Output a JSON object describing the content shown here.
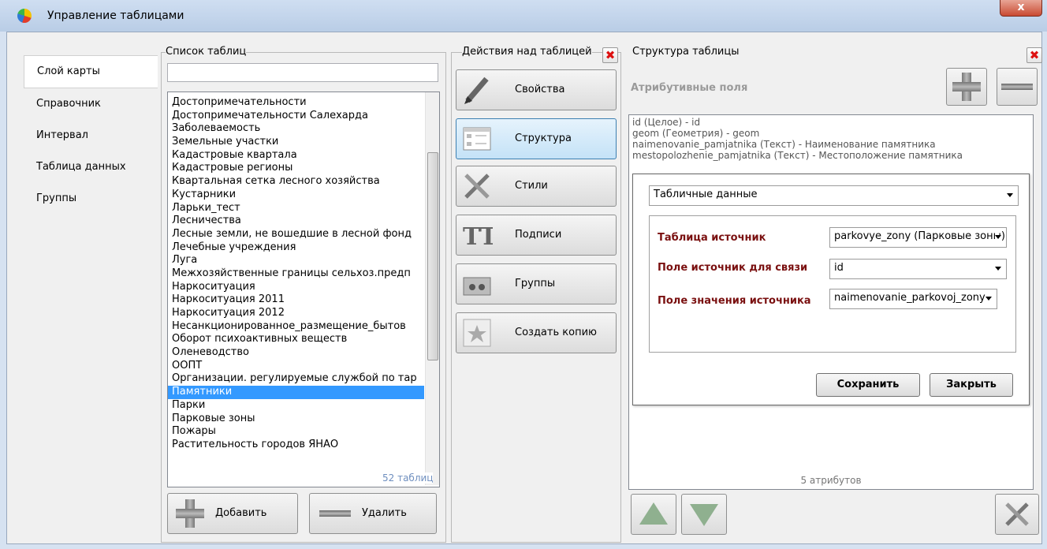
{
  "window": {
    "title": "Управление таблицами",
    "close_glyph": "x"
  },
  "nav": {
    "items": [
      "Слой карты",
      "Справочник",
      "Интервал",
      "Таблица данных",
      "Группы"
    ],
    "selected": 0
  },
  "tables": {
    "group_label": "Список таблиц",
    "search_value": "",
    "items": [
      "Достопримечательности",
      "Достопримечательности Салехарда",
      "Заболеваемость",
      "Земельные участки",
      "Кадастровые квартала",
      "Кадастровые регионы",
      "Квартальная сетка лесного хозяйства",
      "Кустарники",
      "Ларьки_тест",
      "Лесничества",
      "Лесные земли, не вошедшие в лесной фонд",
      "Лечебные учреждения",
      "Луга",
      "Межхозяйственные границы сельхоз.предп",
      "Наркоситуация",
      "Наркоситуация 2011",
      "Наркоситуация 2012",
      "Несанкционированное_размещение_бытов",
      "Оборот психоактивных веществ",
      "Оленеводство",
      "ООПТ",
      "Организации. регулируемые службой по тар",
      "Памятники",
      "Парки",
      "Парковые зоны",
      "Пожары",
      "Растительность городов ЯНАО"
    ],
    "selected_index": 22,
    "count_label": "52 таблиц",
    "add_label": "Добавить",
    "delete_label": "Удалить"
  },
  "actions": {
    "group_label": "Действия над таблицей",
    "close_glyph": "✖",
    "buttons": [
      {
        "label": "Свойства",
        "icon": "pencil-icon"
      },
      {
        "label": "Структура",
        "icon": "structure-icon"
      },
      {
        "label": "Стили",
        "icon": "tools-icon"
      },
      {
        "label": "Подписи",
        "icon": "text-icon"
      },
      {
        "label": "Группы",
        "icon": "folder-icon"
      },
      {
        "label": "Создать копию",
        "icon": "star-icon"
      }
    ],
    "active_index": 1
  },
  "structure": {
    "group_label": "Структура таблицы",
    "close_glyph": "✖",
    "attr_title": "Атрибутивные поля",
    "attributes": [
      "id (Целое) - id",
      "geom (Геометрия) - geom",
      "naimenovanie_pamjatnika (Текст) - Наименование памятника",
      "mestopolozhenie_pamjatnika (Текст) - Местоположение памятника"
    ],
    "attr_count": "5 атрибутов"
  },
  "dialog": {
    "type_value": "Табличные данные",
    "source_table_label": "Таблица источник",
    "source_table_value": "parkovye_zony (Парковые зоны)",
    "link_field_label": "Поле источник для связи",
    "link_field_value": "id",
    "value_field_label": "Поле значения источника",
    "value_field_value": "naimenovanie_parkovoj_zony",
    "save_label": "Сохранить",
    "close_label": "Закрыть"
  },
  "colors": {
    "selection": "#3399ff",
    "field_label": "#7a1010",
    "active_button": "#c4e2f7"
  }
}
